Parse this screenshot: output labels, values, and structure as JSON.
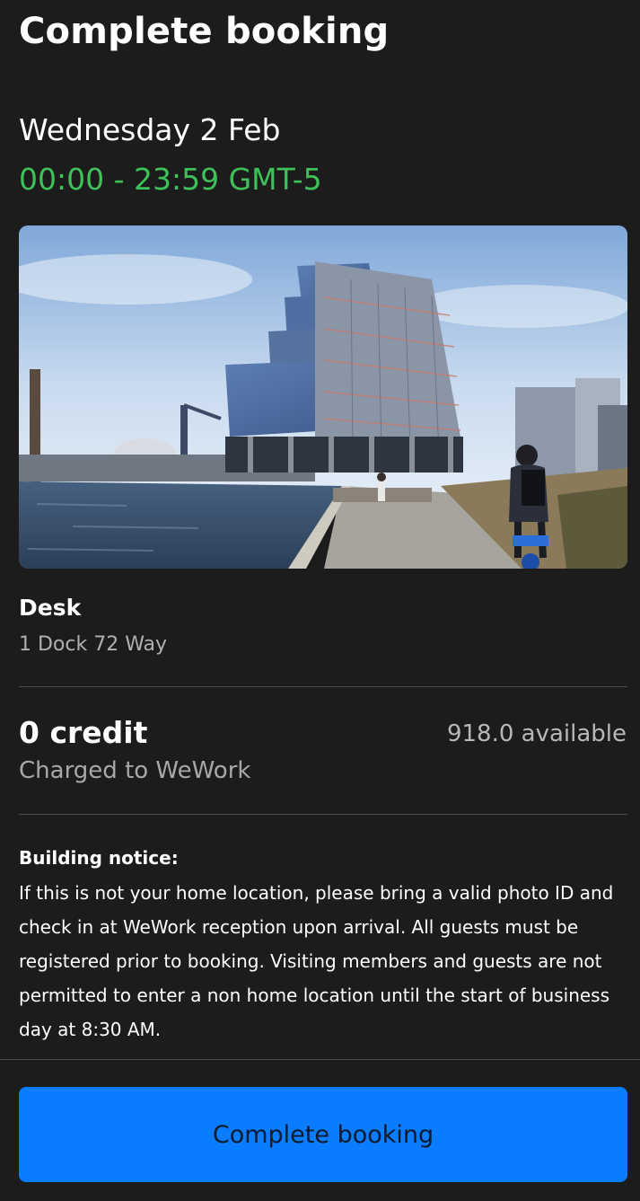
{
  "header": {
    "title": "Complete booking"
  },
  "booking": {
    "date": "Wednesday 2 Feb",
    "time_range": "00:00 - 23:59 GMT-5",
    "space_type": "Desk",
    "address": "1 Dock 72 Way"
  },
  "payment": {
    "cost": "0 credit",
    "charged_to": "Charged to WeWork",
    "available": "918.0 available"
  },
  "notice": {
    "title": "Building notice:",
    "body": "If this is not your home location, please bring a valid photo ID and check in at WeWork reception upon arrival. All guests must be registered prior to booking. Visiting members and guests are not permitted to enter a non home location until the start of business day at 8:30 AM."
  },
  "footer": {
    "button_label": "Complete booking"
  },
  "colors": {
    "background": "#1c1c1c",
    "time_accent": "#3fc15a",
    "button": "#0a7cff"
  }
}
